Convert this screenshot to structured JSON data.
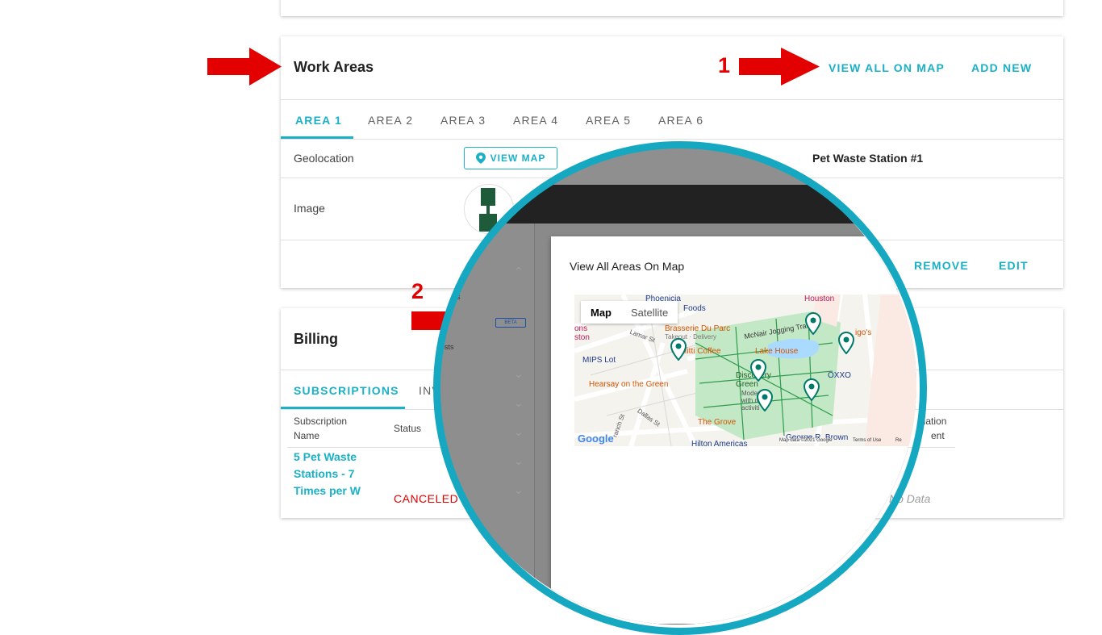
{
  "work_areas": {
    "title": "Work Areas",
    "view_all_on_map": "VIEW ALL ON MAP",
    "add_new": "ADD NEW",
    "tabs": [
      "AREA 1",
      "AREA 2",
      "AREA 3",
      "AREA 4",
      "AREA 5",
      "AREA 6"
    ],
    "geolocation_label": "Geolocation",
    "view_map_button": "VIEW MAP",
    "station_name": "Pet Waste Station #1",
    "image_label": "Image",
    "remove": "REMOVE",
    "edit": "EDIT"
  },
  "billing": {
    "title": "Billing",
    "tabs": [
      "SUBSCRIPTIONS",
      "INV"
    ],
    "columns": {
      "subscription_name": "Subscription Name",
      "status": "Status",
      "termination": "ination",
      "termination_line2": "ent"
    },
    "rows": [
      {
        "name": "5 Pet Waste Stations - 7 Times per W",
        "status": "CANCELED",
        "termination": "No Data"
      }
    ]
  },
  "annotations": {
    "step1": "1",
    "step2": "2"
  },
  "dialog": {
    "title": "View All Areas On Map",
    "map_type_map": "Map",
    "map_type_satellite": "Satellite",
    "sidebar_badge": "BETA",
    "sidebar_text_1": "s",
    "sidebar_text_2": "ests"
  },
  "map_labels": {
    "phoenicia": "Phoenicia",
    "foods": "Foods",
    "houston": "Houston",
    "brasserie": "Brasserie Du Parc",
    "takeout_delivery": "Takeout · Delivery",
    "mcnair": "McNair Jogging Trail",
    "amigos": "igo's",
    "grafitti": "Grafitti Coffee",
    "lake_house": "Lake House",
    "mips": "MIPS Lot",
    "discovery": "Discovery Green",
    "oxxo": "OXXO",
    "hearsay": "Hearsay on the Green",
    "modern": "Modern with m activiti",
    "the_grove": "The Grove",
    "george_brown": "George R. Brown",
    "hilton": "Hilton Americas",
    "lamar": "Lamar St",
    "dallas": "Dallas St",
    "ranch": "ranch St",
    "ons": "ons",
    "ston": "ston",
    "google": "Google",
    "map_data": "Map data ©2021 Google",
    "terms": "Terms of Use",
    "report": "Re"
  },
  "colors": {
    "accent": "#1ab0c6",
    "ring": "#15a8c0",
    "arrow": "#e30000",
    "pin": "#00796b",
    "park": "#c3e8c6"
  }
}
